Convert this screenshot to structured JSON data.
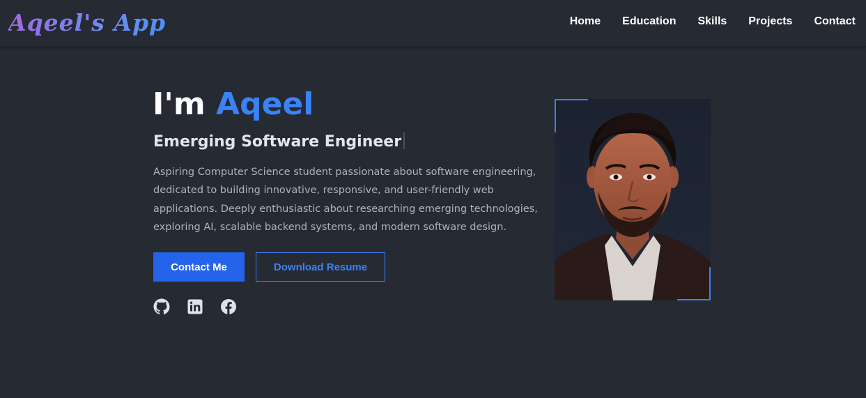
{
  "brand": {
    "name": "Aqeel's App"
  },
  "nav": {
    "items": [
      {
        "label": "Home"
      },
      {
        "label": "Education"
      },
      {
        "label": "Skills"
      },
      {
        "label": "Projects"
      },
      {
        "label": "Contact"
      }
    ]
  },
  "hero": {
    "greeting": "I'm ",
    "name": "Aqeel",
    "subtitle": "Emerging Software Engineer",
    "description": "Aspiring Computer Science student passionate about software engineering, dedicated to building innovative, responsive, and user-friendly web applications. Deeply enthusiastic about researching emerging technologies, exploring AI, scalable backend systems, and modern software design.",
    "primary_button": "Contact Me",
    "secondary_button": "Download Resume",
    "socials": [
      {
        "icon": "github-icon"
      },
      {
        "icon": "linkedin-icon"
      },
      {
        "icon": "facebook-icon"
      }
    ]
  },
  "colors": {
    "background": "#262a33",
    "accent": "#3b82f6",
    "primary_button": "#2563eb",
    "text": "#ffffff",
    "muted_text": "#aeb3bd"
  }
}
